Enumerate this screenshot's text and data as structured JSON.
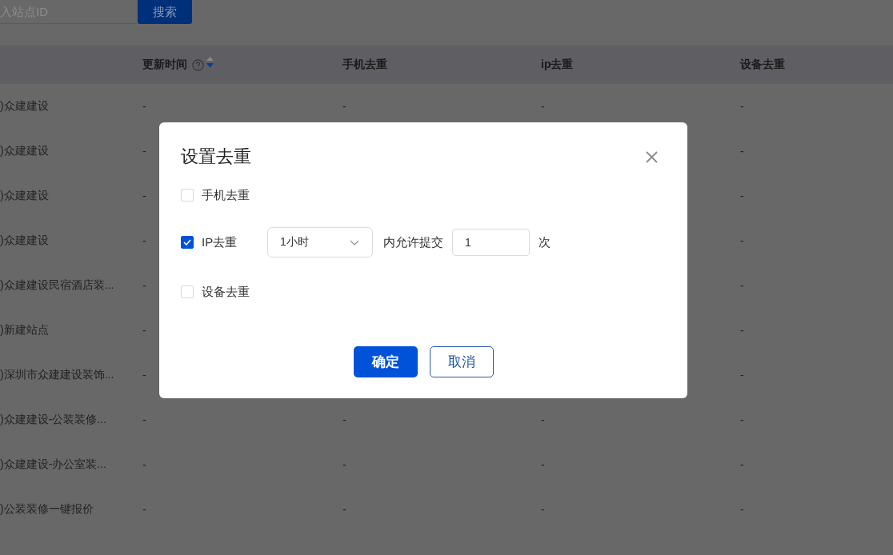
{
  "search": {
    "placeholder": "入站点ID",
    "button": "搜索"
  },
  "table": {
    "columns": [
      {
        "label": "更新时间",
        "help": true,
        "sort": {
          "ascending": false,
          "descending": true
        }
      },
      {
        "label": "手机去重"
      },
      {
        "label": "ip去重"
      },
      {
        "label": "设备去重"
      }
    ],
    "rows": [
      {
        "column_1": ")众建建设",
        "cells": [
          "-",
          "-",
          "-",
          "-"
        ]
      },
      {
        "column_1": ")众建建设",
        "cells": [
          "-",
          null,
          null,
          "-"
        ]
      },
      {
        "column_1": ")众建建设",
        "cells": [
          "-",
          null,
          null,
          "-"
        ]
      },
      {
        "column_1": ")众建建设",
        "cells": [
          "-",
          null,
          null,
          "-"
        ]
      },
      {
        "column_1": ")众建建设民宿酒店装...",
        "cells": [
          "-",
          null,
          null,
          "-"
        ]
      },
      {
        "column_1": ")新建站点",
        "cells": [
          "-",
          null,
          null,
          "-"
        ]
      },
      {
        "column_1": ")深圳市众建建设装饰...",
        "cells": [
          "-",
          null,
          null,
          "-"
        ]
      },
      {
        "column_1": ")众建建设-公装装修...",
        "cells": [
          "-",
          "-",
          "-",
          "-"
        ]
      },
      {
        "column_1": ")众建建设-办公室装...",
        "cells": [
          "-",
          "-",
          "-",
          "-"
        ]
      },
      {
        "column_1": ")公装装修一键报价",
        "cells": [
          "-",
          "-",
          "-",
          "-"
        ]
      }
    ]
  },
  "dialog": {
    "title": "设置去重",
    "options": [
      {
        "kind": "checkbox",
        "label": "手机去重",
        "checked": false
      },
      {
        "kind": "limit",
        "label": "IP去重",
        "checked": true,
        "period": "1小时",
        "text": "内允许提交",
        "count": "1",
        "unit": "次"
      },
      {
        "kind": "checkbox",
        "label": "设备去重",
        "checked": false
      }
    ],
    "buttons": [
      {
        "kind": "primary",
        "label": "确定"
      },
      {
        "kind": "default",
        "label": "取消"
      }
    ]
  }
}
